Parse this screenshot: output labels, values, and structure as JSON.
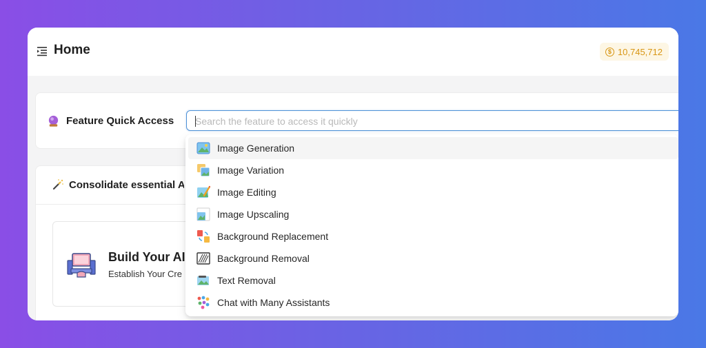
{
  "header": {
    "title": "Home",
    "credits": "10,745,712",
    "credits_icon": "coin-icon",
    "menu_icon": "menu-collapse-icon"
  },
  "quick_access": {
    "label": "Feature Quick Access",
    "icon": "crystal-ball-icon",
    "search_placeholder": "Search the feature to access it quickly",
    "search_value": ""
  },
  "dropdown": {
    "items": [
      {
        "label": "Image Generation",
        "icon": "image-generation-icon",
        "active": true
      },
      {
        "label": "Image Variation",
        "icon": "image-variation-icon",
        "active": false
      },
      {
        "label": "Image Editing",
        "icon": "image-editing-icon",
        "active": false
      },
      {
        "label": "Image Upscaling",
        "icon": "image-upscaling-icon",
        "active": false
      },
      {
        "label": "Background Replacement",
        "icon": "background-replacement-icon",
        "active": false
      },
      {
        "label": "Background Removal",
        "icon": "background-removal-icon",
        "active": false
      },
      {
        "label": "Text Removal",
        "icon": "text-removal-icon",
        "active": false
      },
      {
        "label": "Chat with Many Assistants",
        "icon": "chat-assistants-icon",
        "active": false
      }
    ]
  },
  "consolidate": {
    "title": "Consolidate essential A",
    "icon": "magic-wand-icon",
    "card": {
      "title": "Build Your AI",
      "subtitle": "Establish Your Cre",
      "icon": "workstation-icon"
    }
  },
  "colors": {
    "accent": "#4a8fd6",
    "credits": "#d89614",
    "credits_bg": "#fdf6e4",
    "background_gradient": [
      "#8a4ee6",
      "#4a78e6"
    ]
  }
}
